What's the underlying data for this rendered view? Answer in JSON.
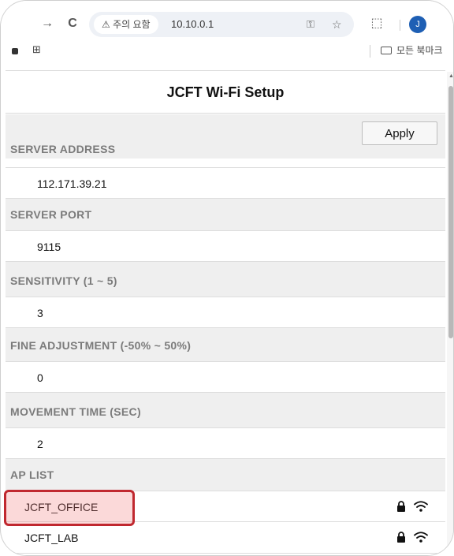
{
  "browser": {
    "nav_forward": "→",
    "reload": "C",
    "security_chip": "⚠ 주의 요함",
    "url": "10.10.0.1",
    "profile_initial": "J",
    "bookmarks": {
      "apps": "⊞",
      "folder_label": "모든 북마크"
    }
  },
  "page": {
    "title": "JCFT Wi-Fi Setup",
    "apply_label": "Apply",
    "fields": [
      {
        "label": "SERVER ADDRESS",
        "value": "112.171.39.21"
      },
      {
        "label": "SERVER PORT",
        "value": "9115"
      },
      {
        "label": "SENSITIVITY (1 ~ 5)",
        "value": "3"
      },
      {
        "label": "FINE ADJUSTMENT (-50% ~ 50%)",
        "value": "0"
      },
      {
        "label": "MOVEMENT TIME (SEC)",
        "value": "2"
      }
    ],
    "ap_list_label": "AP LIST",
    "ap_list": [
      {
        "name": "JCFT_OFFICE",
        "secured": true
      },
      {
        "name": "JCFT_LAB",
        "secured": true
      }
    ]
  },
  "colors": {
    "highlight_border": "#c0282f",
    "section_bg": "#efefef",
    "label_text": "#7b7b7b"
  }
}
